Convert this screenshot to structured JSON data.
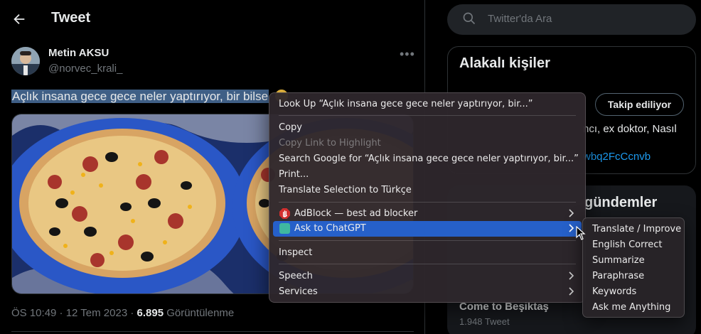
{
  "header": {
    "title": "Tweet"
  },
  "tweet": {
    "author_name": "Metin AKSU",
    "author_handle": "@norvec_krali_",
    "text_selected": "Açlık insana gece gece neler yaptırıyor, bir bilse",
    "text_rest": " ",
    "timestamp": "ÖS 10:49 · 12 Tem 2023 · ",
    "views_count": "6.895",
    "views_label": " Görüntülenme"
  },
  "sidebar": {
    "search_placeholder": "Twitter'da Ara",
    "related_title": "Alakalı kişiler",
    "follow_button": "Takip ediliyor",
    "bio_snippet": "ncı, ex doktor, Nasıl",
    "link_snippet": "wbq2FcCcnvb",
    "trends_title": "gündemler",
    "trend_name": "Come to Beşiktaş",
    "trend_count": "1.948 Tweet"
  },
  "context_menu": {
    "items": [
      {
        "label": "Look Up “Açlık insana gece gece neler yaptırıyor, bir...”"
      },
      {
        "label": "Copy"
      },
      {
        "label": "Copy Link to Highlight",
        "disabled": true
      },
      {
        "label": "Search Google for “Açlık insana gece gece neler yaptırıyor, bir...”"
      },
      {
        "label": "Print..."
      },
      {
        "label": "Translate Selection to Türkçe"
      },
      {
        "label": "AdBlock — best ad blocker",
        "icon": "adblock-hand-icon",
        "submenu": true
      },
      {
        "label": "Ask to ChatGPT",
        "icon": "chatgpt-icon",
        "submenu": true,
        "active": true
      },
      {
        "label": "Inspect"
      },
      {
        "label": "Speech",
        "submenu": true
      },
      {
        "label": "Services",
        "submenu": true
      }
    ]
  },
  "submenu": {
    "items": [
      "Translate / Improve",
      "English Correct",
      "Summarize",
      "Paraphrase",
      "Keywords",
      "Ask me Anything"
    ]
  },
  "colors": {
    "accent": "#1d9bf0",
    "menu_highlight": "#2660c9",
    "adblock_red": "#d32f2f",
    "chatgpt_green": "#3fb8a0"
  },
  "icons": [
    "back-arrow-icon",
    "more-icon",
    "search-icon",
    "adblock-hand-icon",
    "chatgpt-icon",
    "chevron-right-icon",
    "pointer-cursor-icon"
  ]
}
